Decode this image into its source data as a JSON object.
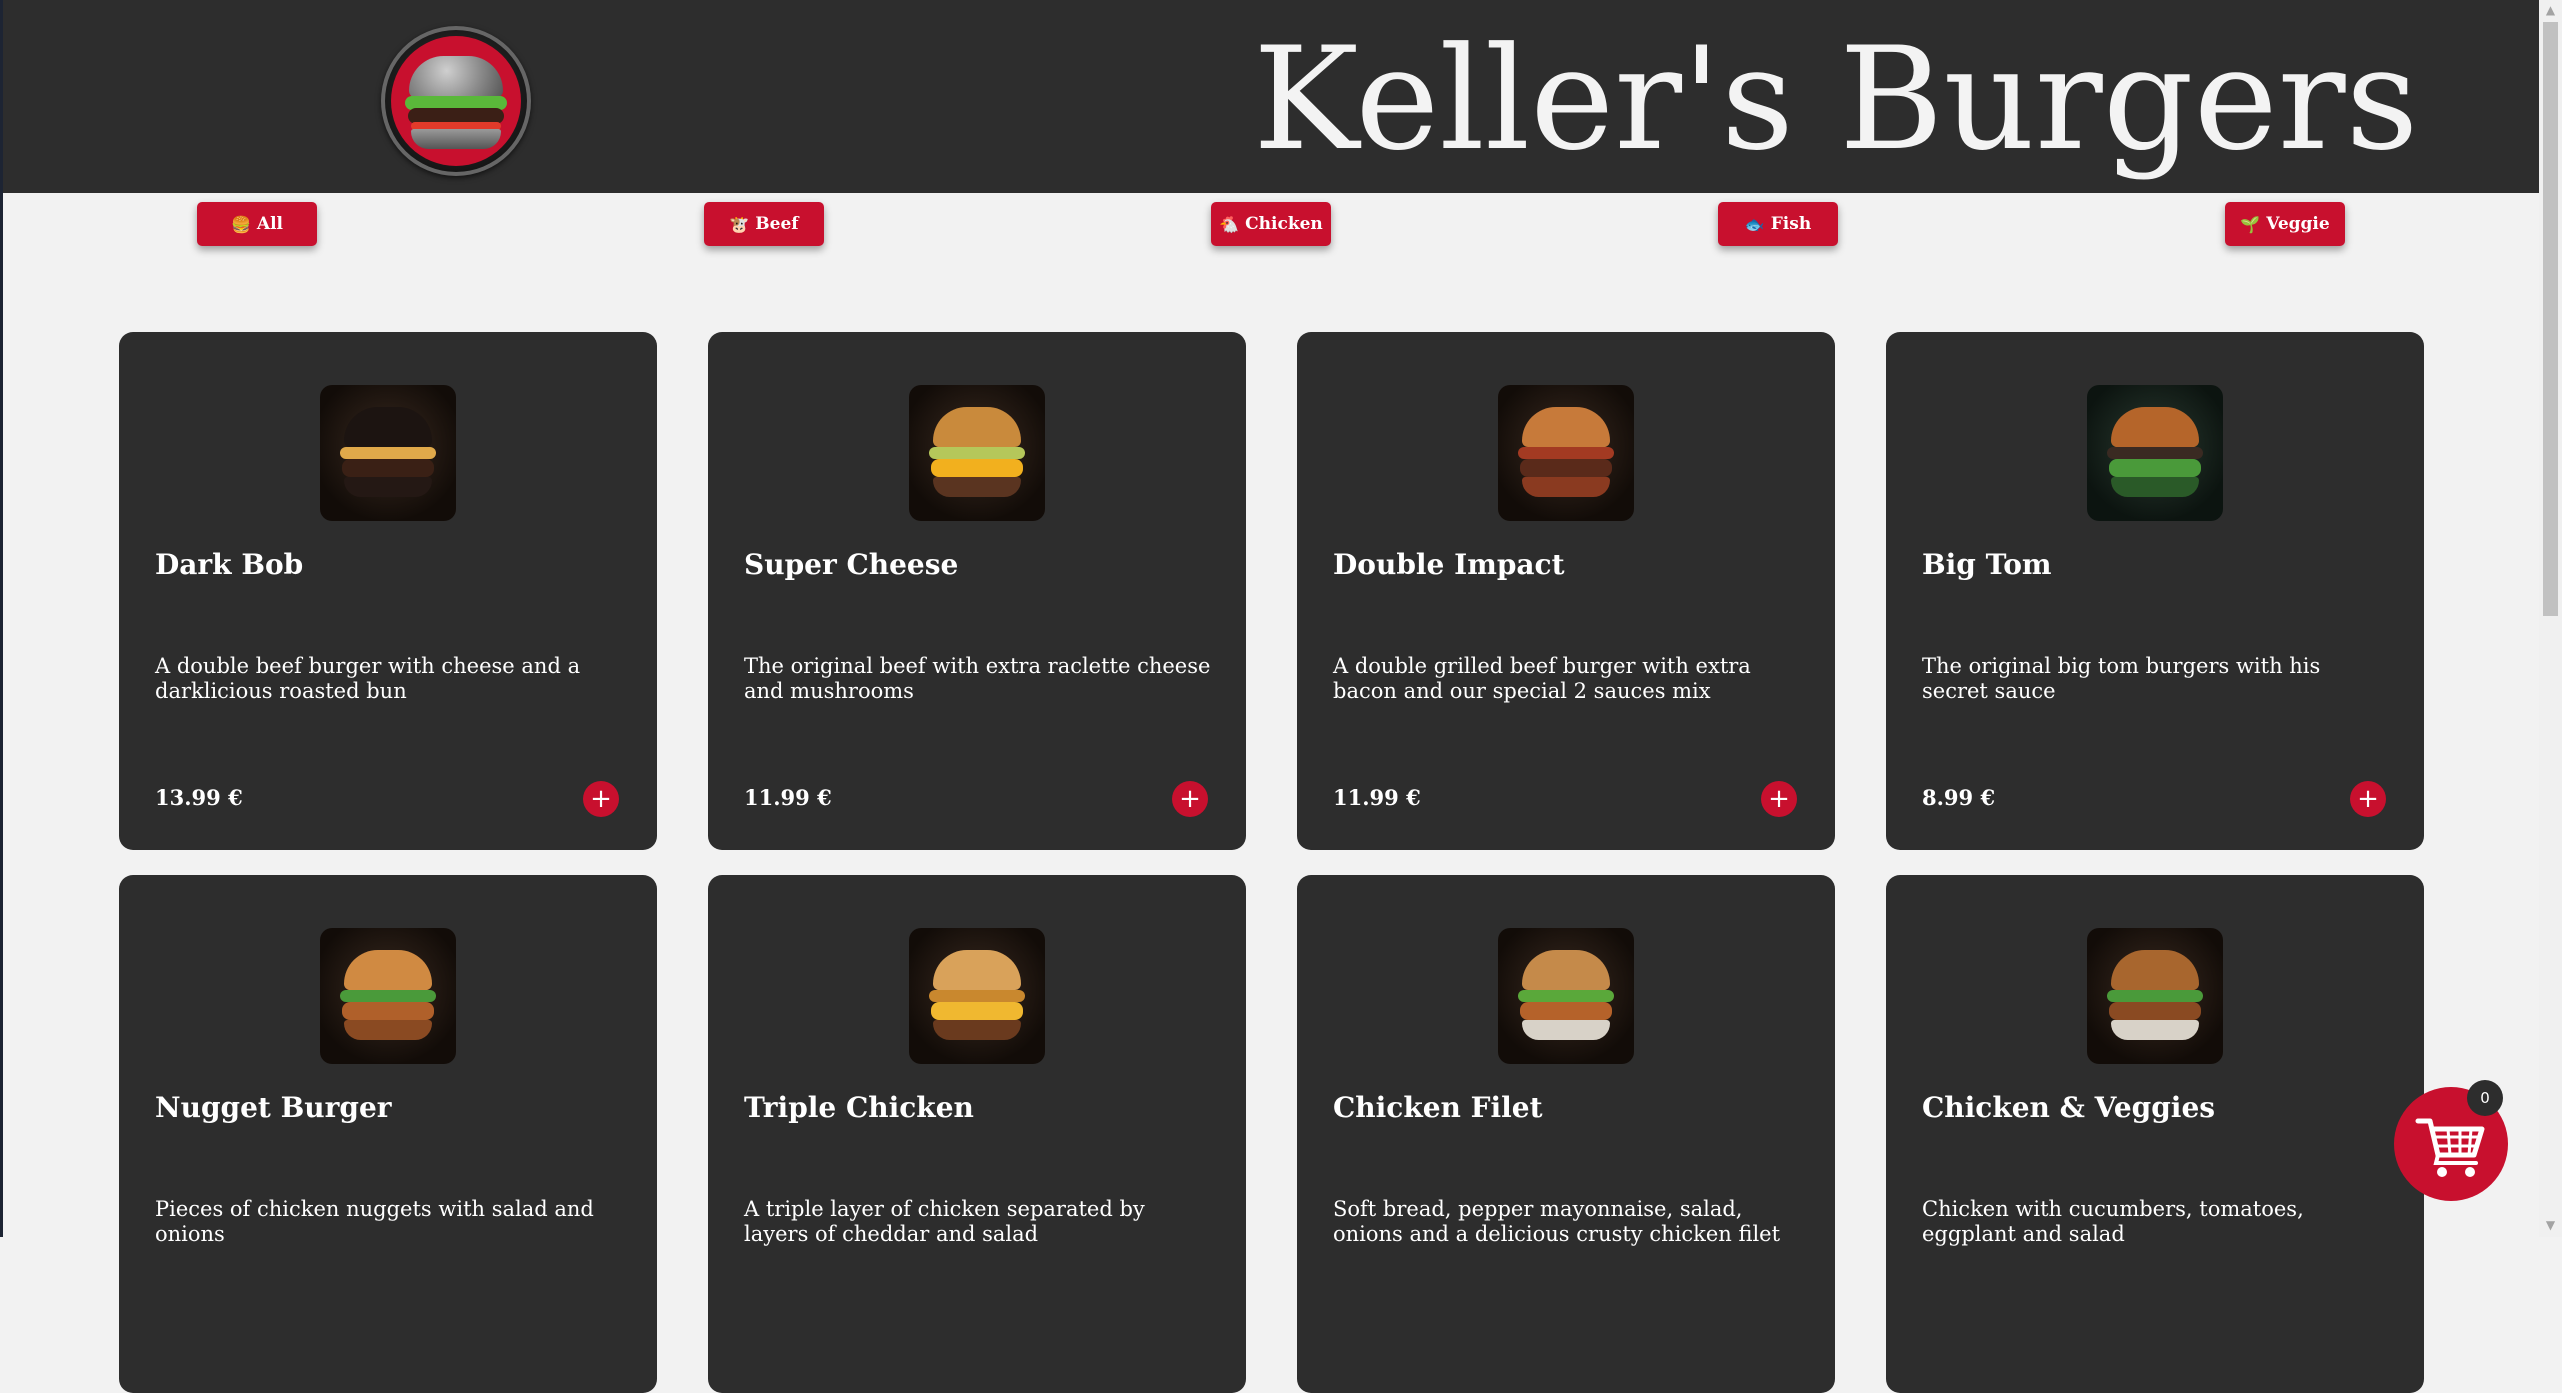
{
  "header": {
    "title": "Keller's Burgers",
    "logo_icon": "burger-logo-icon"
  },
  "filters": [
    {
      "icon": "🍔",
      "label": "All"
    },
    {
      "icon": "🐮",
      "label": "Beef"
    },
    {
      "icon": "🐔",
      "label": "Chicken"
    },
    {
      "icon": "🐟",
      "label": "Fish"
    },
    {
      "icon": "🌱",
      "label": "Veggie"
    }
  ],
  "products": [
    {
      "name": "Dark Bob",
      "description": "A double beef burger with cheese and a darklicious roasted bun",
      "price": "13.99 €"
    },
    {
      "name": "Super Cheese",
      "description": "The original beef with extra raclette cheese and mushrooms",
      "price": "11.99 €"
    },
    {
      "name": "Double Impact",
      "description": "A double grilled beef burger with extra bacon and our special 2 sauces mix",
      "price": "11.99 €"
    },
    {
      "name": "Big Tom",
      "description": "The original big tom burgers with his secret sauce",
      "price": "8.99 €"
    },
    {
      "name": "Nugget Burger",
      "description": "Pieces of chicken nuggets with salad and onions",
      "price": ""
    },
    {
      "name": "Triple Chicken",
      "description": "A triple layer of chicken separated by layers of cheddar and salad",
      "price": ""
    },
    {
      "name": "Chicken Filet",
      "description": "Soft bread, pepper mayonnaise, salad, onions and a delicious crusty chicken filet",
      "price": ""
    },
    {
      "name": "Chicken & Veggies",
      "description": "Chicken with cucumbers, tomatoes, eggplant and salad",
      "price": ""
    }
  ],
  "add_button_label": "+",
  "cart": {
    "count": "0",
    "icon": "shopping-cart-icon"
  },
  "colors": {
    "accent": "#c8102e",
    "header_bg": "#2d2d2d",
    "card_bg": "#2d2d2d",
    "page_bg": "#f2f2f2"
  }
}
